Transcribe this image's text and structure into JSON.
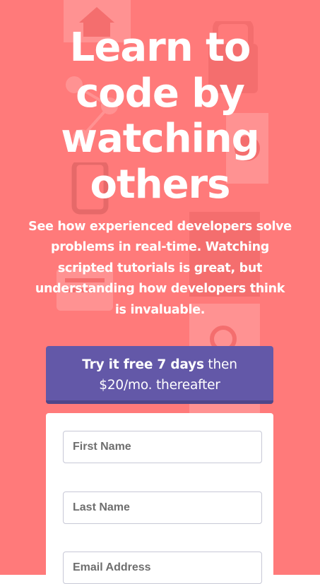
{
  "theme": {
    "background": "#ff7a7a",
    "cta_background": "#6358a8",
    "cta_shadow": "#4f4689",
    "text_light": "#ffffff"
  },
  "hero": {
    "headline_lines": [
      "Learn to",
      "code by",
      "watching",
      "others"
    ],
    "subtext_lines": [
      "See how experienced developers solve",
      "problems in real-time. Watching",
      "scripted tutorials is great, but",
      "understanding how developers think",
      "is invaluable."
    ]
  },
  "cta": {
    "bold_text": "Try it free 7 days",
    "rest_text": " then",
    "second_line": "$20/mo. thereafter"
  },
  "form": {
    "first_name_placeholder": "First Name",
    "last_name_placeholder": "Last Name",
    "email_placeholder": "Email Address"
  },
  "background_icons": [
    "home-icon",
    "lock-icon",
    "gear-icon",
    "bug-icon",
    "search-icon",
    "chat-icon",
    "flow-icon"
  ]
}
